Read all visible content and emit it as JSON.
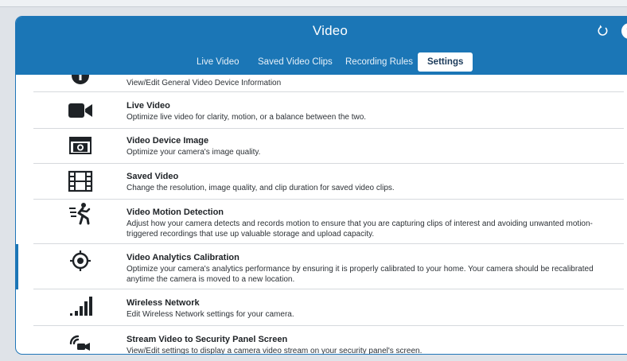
{
  "header": {
    "title": "Video",
    "help_label": "?"
  },
  "tabs": [
    {
      "label": "Live Video",
      "active": false
    },
    {
      "label": "Saved Video Clips",
      "active": false
    },
    {
      "label": "Recording Rules",
      "active": false
    },
    {
      "label": "Settings",
      "active": true
    }
  ],
  "settings": [
    {
      "name": "",
      "description": "View/Edit General Video Device Information",
      "icon": "info-icon"
    },
    {
      "name": "Live Video",
      "description": "Optimize live video for clarity, motion, or a balance between the two.",
      "icon": "video-camera-icon"
    },
    {
      "name": "Video Device Image",
      "description": "Optimize your camera's image quality.",
      "icon": "camera-icon"
    },
    {
      "name": "Saved Video",
      "description": "Change the resolution, image quality, and clip duration for saved video clips.",
      "icon": "film-icon"
    },
    {
      "name": "Video Motion Detection",
      "description": "Adjust how your camera detects and records motion to ensure that you are capturing clips of interest and avoiding unwanted motion-triggered recordings that use up valuable storage and upload capacity.",
      "icon": "motion-icon"
    },
    {
      "name": "Video Analytics Calibration",
      "description": "Optimize your camera's analytics performance by ensuring it is properly calibrated to your home. Your camera should be recalibrated anytime the camera is moved to a new location.",
      "icon": "target-icon"
    },
    {
      "name": "Wireless Network",
      "description": "Edit Wireless Network settings for your camera.",
      "icon": "signal-bars-icon"
    },
    {
      "name": "Stream Video to Security Panel Screen",
      "description": "View/Edit settings to display a camera video stream on your security panel's screen.",
      "icon": "stream-icon"
    }
  ],
  "colors": {
    "header_blue": "#1b76b6",
    "accent_blue": "#1b76b6",
    "background": "#dfe3e8"
  }
}
